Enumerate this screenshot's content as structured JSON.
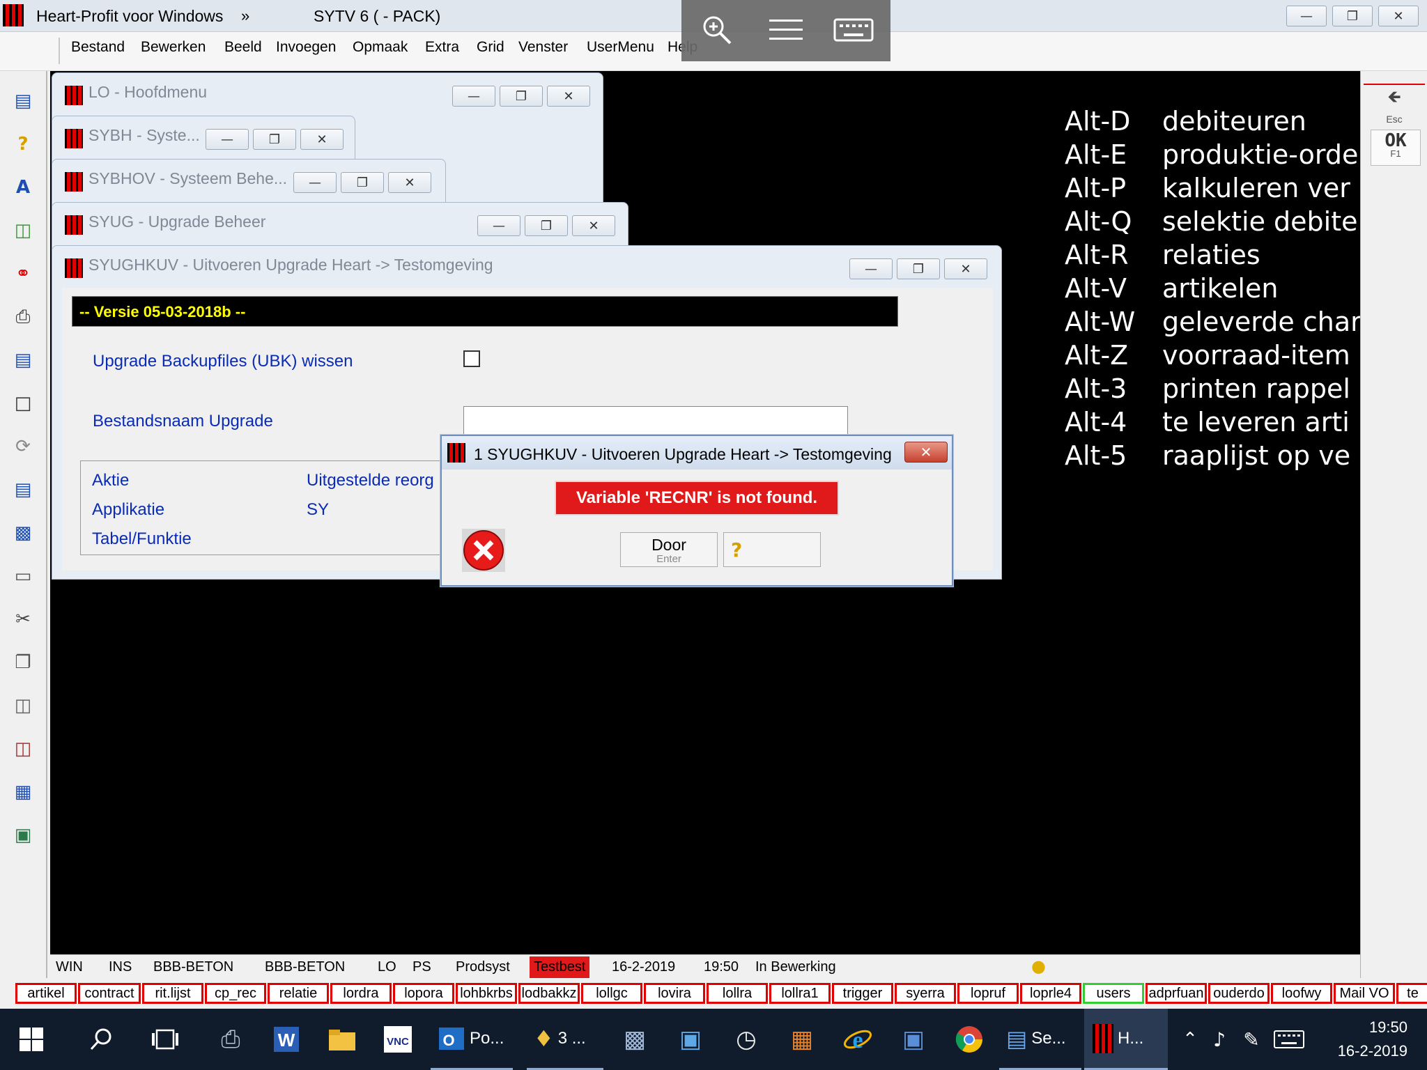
{
  "app": {
    "title": "Heart-Profit voor Windows",
    "title_more": "»",
    "system": "SYTV 6  ( - PACK)"
  },
  "menu": [
    "Bestand",
    "Bewerken",
    "Beeld",
    "Invoegen",
    "Opmaak",
    "Extra",
    "Grid",
    "Venster",
    "UserMenu",
    "Help"
  ],
  "right_toolbar": {
    "esc": "Esc",
    "ok": "OK",
    "f1": "F1"
  },
  "windows": {
    "hoofdmenu": "LO - Hoofdmenu",
    "sybh": "SYBH - Syste...",
    "sybhov": "SYBHOV - Systeem Behe...",
    "syug": "SYUG - Upgrade Beheer",
    "syughkuv": "SYUGHKUV - Uitvoeren Upgrade Heart -> Testomgeving"
  },
  "form": {
    "version": "-- Versie 05-03-2018b --",
    "backup_label": "Upgrade Backupfiles (UBK) wissen",
    "backup_checked": false,
    "filename_label": "Bestandsnaam Upgrade",
    "filename_value": "",
    "aktie_label": "Aktie",
    "aktie_value": "Uitgestelde reorg",
    "applikatie_label": "Applikatie",
    "applikatie_value": "SY",
    "tabel_label": "Tabel/Funktie"
  },
  "dialog": {
    "title": "1 SYUGHKUV - Uitvoeren Upgrade Heart -> Testomgeving",
    "message": "Variable 'RECNR' is not found.",
    "door_label": "Door",
    "door_sub": "Enter",
    "help_icon": "question-icon"
  },
  "hotkeys": [
    {
      "key": "Alt-D",
      "label": "debiteuren"
    },
    {
      "key": "Alt-E",
      "label": "produktie-orde"
    },
    {
      "key": "Alt-P",
      "label": "kalkuleren ver"
    },
    {
      "key": "Alt-Q",
      "label": "selektie debite"
    },
    {
      "key": "Alt-R",
      "label": "relaties"
    },
    {
      "key": "Alt-V",
      "label": "artikelen"
    },
    {
      "key": "Alt-W",
      "label": "geleverde char"
    },
    {
      "key": "Alt-Z",
      "label": "voorraad-item"
    },
    {
      "key": "Alt-3",
      "label": "printen rappel"
    },
    {
      "key": "Alt-4",
      "label": "te leveren arti"
    },
    {
      "key": "Alt-5",
      "label": "raaplijst op ve"
    }
  ],
  "status": {
    "win": "WIN",
    "ins": "INS",
    "company1": "BBB-BETON",
    "company2": "BBB-BETON",
    "lo": "LO",
    "ps": "PS",
    "prodsyst": "Prodsyst",
    "testbest": "Testbest",
    "date": "16-2-2019",
    "time": "19:50",
    "state": "In Bewerking"
  },
  "tabs": [
    "artikel",
    "contract",
    "rit.lijst",
    "cp_rec",
    "relatie",
    "lordra",
    "lopora",
    "lohbkrbs",
    "lodbakkz",
    "lollgc",
    "lovira",
    "lollra",
    "lollra1",
    "trigger",
    "syerra",
    "lopruf",
    "loprle4",
    "users",
    "adprfuan",
    "ouderdo",
    "loofwy",
    "Mail VO",
    "te"
  ],
  "taskbar": {
    "outlook_label": "Po...",
    "reminder_label": "3 ...",
    "se_label": "Se...",
    "heart_label": "H...",
    "clock_time": "19:50",
    "clock_date": "16-2-2019"
  },
  "colors": {
    "mdi_background": "#000000",
    "error_red": "#e01a1a",
    "label_blue": "#0a2bb5",
    "version_yellow": "#ffff00",
    "tab_border_red": "#e00000",
    "tab_border_green": "#33cc33"
  }
}
